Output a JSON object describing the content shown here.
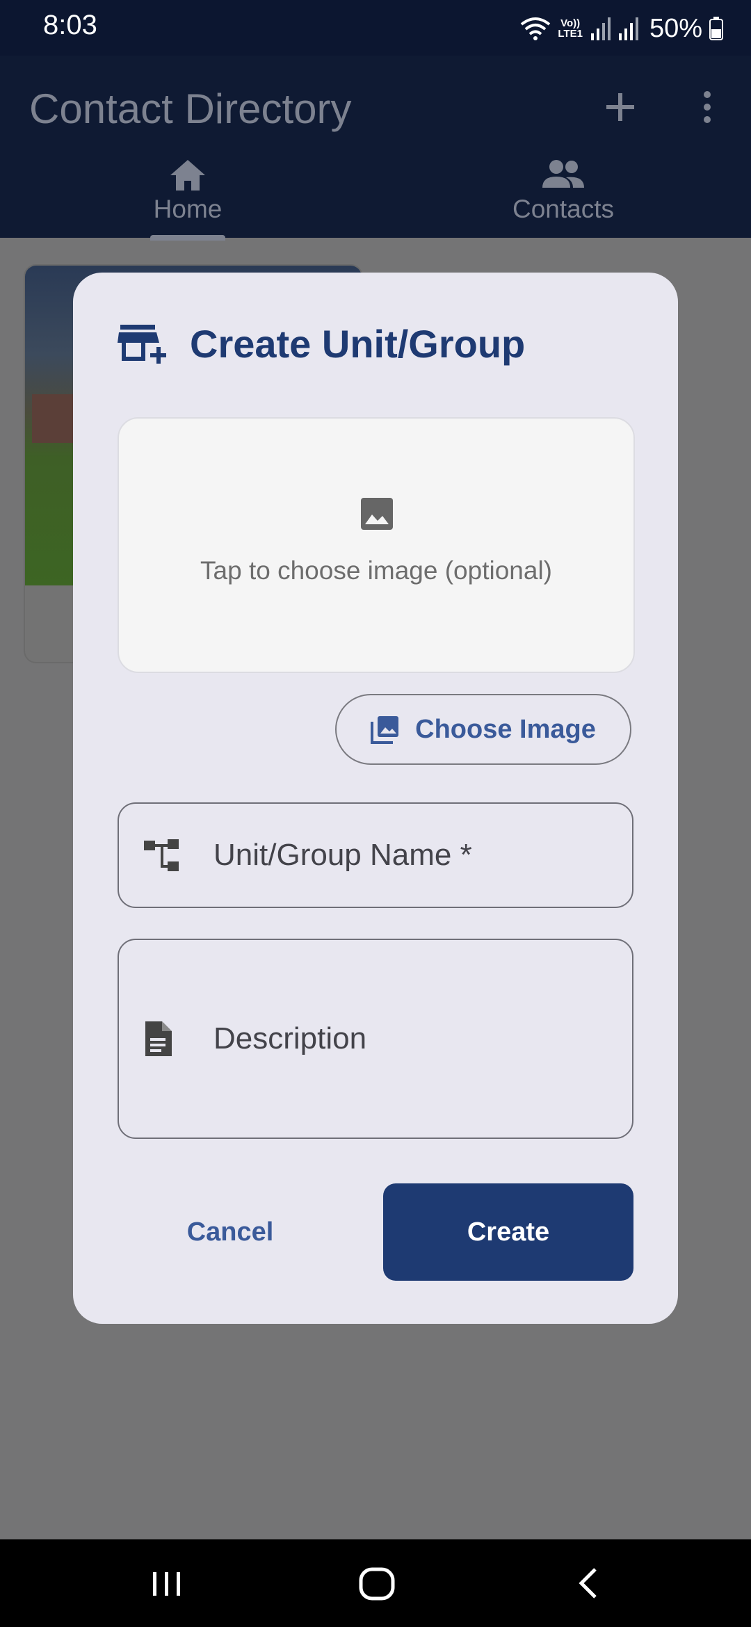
{
  "status_bar": {
    "time": "8:03",
    "network_label": "Vo))\nLTE1",
    "battery_percent": "50%",
    "icons": [
      "wifi-icon",
      "volte-icon",
      "signal-icon",
      "signal-icon",
      "battery-icon"
    ]
  },
  "app_bar": {
    "title": "Contact Directory",
    "actions": [
      "add-icon",
      "more-vert-icon"
    ],
    "tabs": [
      {
        "label": "Home",
        "icon": "home-icon",
        "selected": true
      },
      {
        "label": "Contacts",
        "icon": "people-icon",
        "selected": false
      }
    ]
  },
  "dialog": {
    "title": "Create Unit/Group",
    "title_icon": "add-business-icon",
    "image_picker": {
      "hint": "Tap to choose image (optional)",
      "icon": "image-icon"
    },
    "choose_image_label": "Choose Image",
    "name_field": {
      "placeholder": "Unit/Group Name *",
      "value": "",
      "icon": "account-tree-icon"
    },
    "description_field": {
      "placeholder": "Description",
      "value": "",
      "icon": "description-icon"
    },
    "cancel_label": "Cancel",
    "create_label": "Create"
  },
  "colors": {
    "primary": "#1e3a72",
    "accent_text": "#3a5a9a",
    "dialog_surface": "#e8e7f0",
    "scrim": "#747475"
  }
}
